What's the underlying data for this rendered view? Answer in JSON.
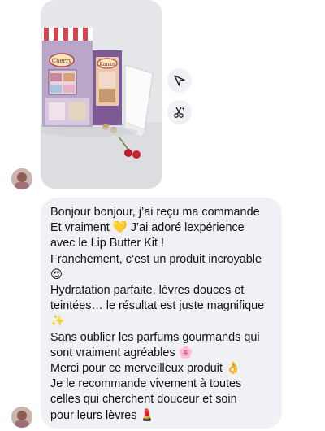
{
  "conversation": {
    "attachment": {
      "kind": "photo",
      "packaging_sign_left": "Cherry",
      "packaging_sign_right": "Kanan"
    },
    "actions": [
      {
        "icon": "share-icon",
        "name": "share-button"
      },
      {
        "icon": "scissors-sparkle-icon",
        "name": "remix-button"
      }
    ],
    "message": {
      "lines": [
        "Bonjour bonjour, j’ai reçu ma commande",
        "Et vraiment 💛  J’ai adoré lexpérience",
        "avec le Lip Butter Kit !",
        "Franchement, c’est un produit incroyable",
        "😍",
        "Hydratation parfaite, lèvres douces et",
        "teintées… le résultat est juste magnifique",
        "✨",
        "Sans oublier les parfums gourmands qui",
        "sont vraiment agréables 🌸",
        "Merci pour ce merveilleux produit 👌",
        "Je le recommande vivement à toutes",
        "celles qui cherchent douceur et soin",
        "pour leurs lèvres 💄"
      ]
    }
  },
  "colors": {
    "bubble_bg": "#f0f1f4",
    "text": "#111111",
    "icon": "#1c1e21"
  }
}
